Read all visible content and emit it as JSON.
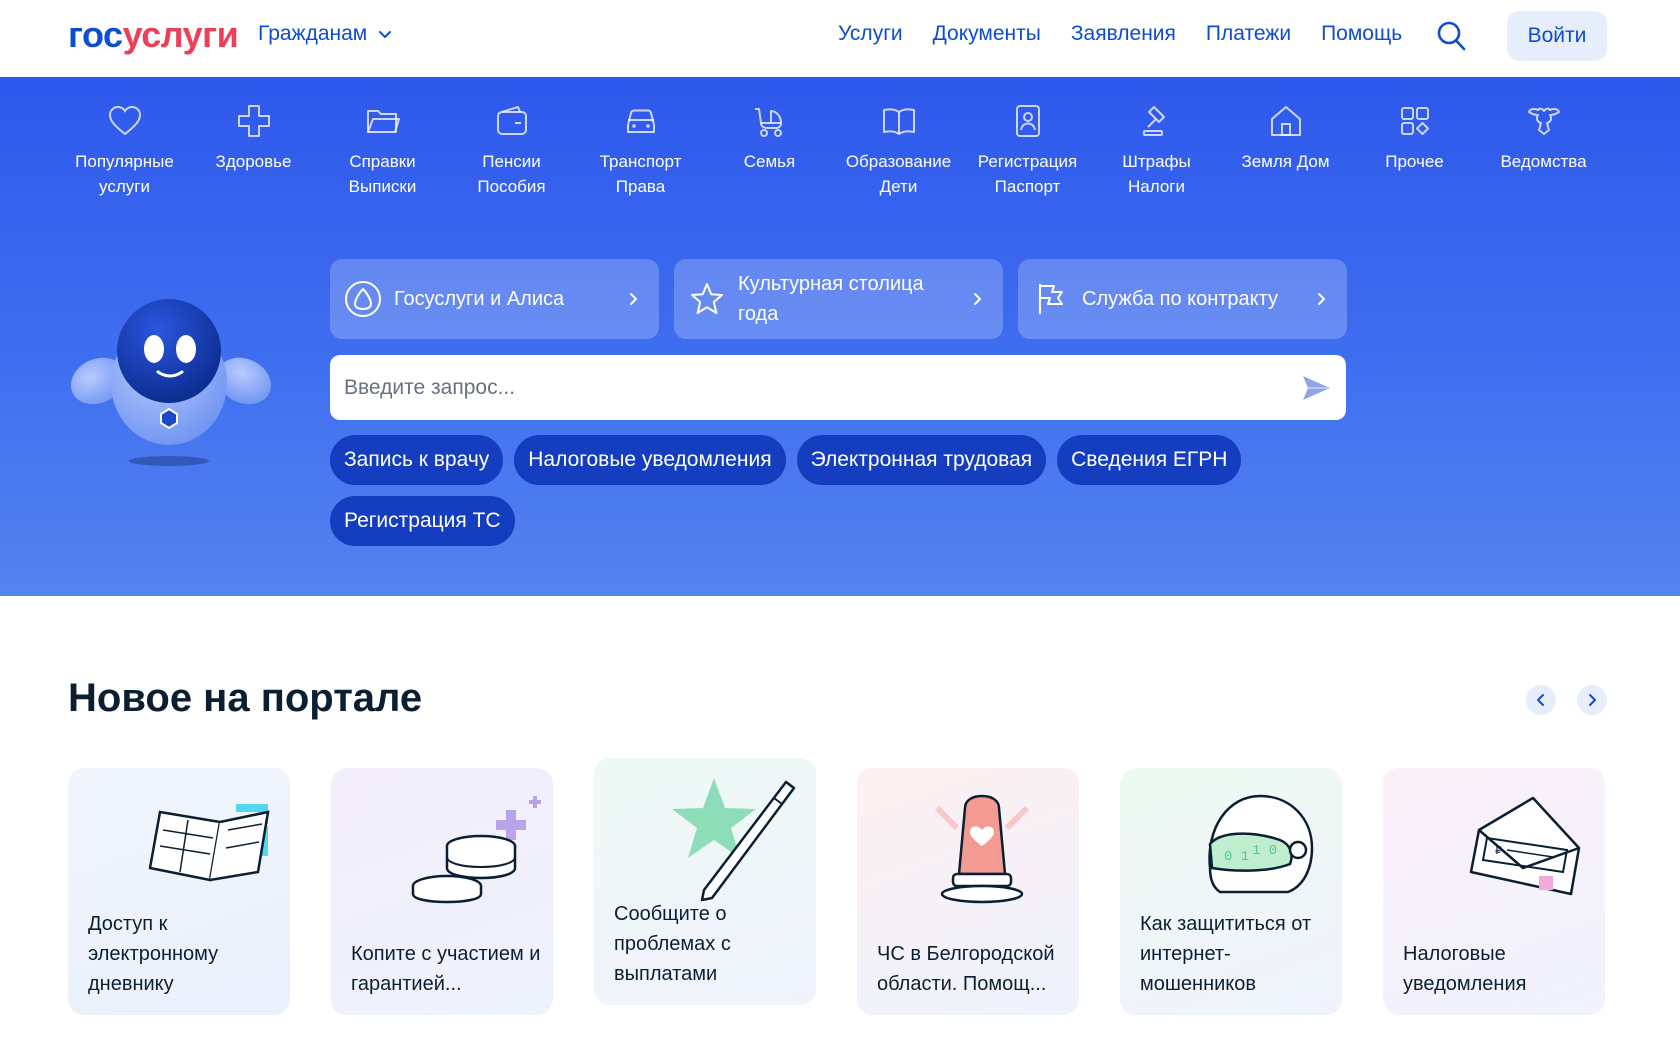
{
  "header": {
    "logo": {
      "part1": "гос",
      "part2": "услуги"
    },
    "audience": "Гражданам",
    "nav": [
      "Услуги",
      "Документы",
      "Заявления",
      "Платежи",
      "Помощь"
    ],
    "login": "Войти",
    "colors": {
      "primary": "#0d4cd3",
      "logo_accent": "#ee3f58"
    }
  },
  "categories": [
    {
      "icon": "heart-icon",
      "lines": [
        "Популярные",
        "услуги"
      ]
    },
    {
      "icon": "cross-icon",
      "lines": [
        "Здоровье",
        ""
      ]
    },
    {
      "icon": "folder-icon",
      "lines": [
        "Справки",
        "Выписки"
      ]
    },
    {
      "icon": "wallet-icon",
      "lines": [
        "Пенсии",
        "Пособия"
      ]
    },
    {
      "icon": "car-icon",
      "lines": [
        "Транспорт",
        "Права"
      ]
    },
    {
      "icon": "stroller-icon",
      "lines": [
        "Семья",
        ""
      ]
    },
    {
      "icon": "book-icon",
      "lines": [
        "Образование",
        "Дети"
      ]
    },
    {
      "icon": "id-card-icon",
      "lines": [
        "Регистрация",
        "Паспорт"
      ]
    },
    {
      "icon": "gavel-icon",
      "lines": [
        "Штрафы",
        "Налоги"
      ]
    },
    {
      "icon": "house-icon",
      "lines": [
        "Земля Дом",
        ""
      ]
    },
    {
      "icon": "grid-icon",
      "lines": [
        "Прочее",
        ""
      ]
    },
    {
      "icon": "eagle-icon",
      "lines": [
        "Ведомства",
        ""
      ]
    }
  ],
  "promos": [
    {
      "icon": "alice-icon",
      "title": "Госуслуги и Алиса"
    },
    {
      "icon": "star-icon",
      "title": "Культурная столица года"
    },
    {
      "icon": "flag-icon",
      "title": "Служба по контракту"
    }
  ],
  "search": {
    "placeholder": "Введите запрос..."
  },
  "chips": [
    "Запись к врачу",
    "Налоговые уведомления",
    "Электронная трудовая",
    "Сведения ЕГРН",
    "Регистрация ТС"
  ],
  "news": {
    "title": "Новое на портале",
    "cards": [
      "Доступ к электронному дневнику",
      "Копите с участием и гарантией...",
      "Сообщите о проблемах с выплатами",
      "ЧС в Белгородской области. Помощ...",
      "Как защититься от интернет-мошенников",
      "Налоговые уведомления"
    ]
  },
  "hero_colors": {
    "background": "#3f6ff0",
    "chip": "#143ebf"
  }
}
